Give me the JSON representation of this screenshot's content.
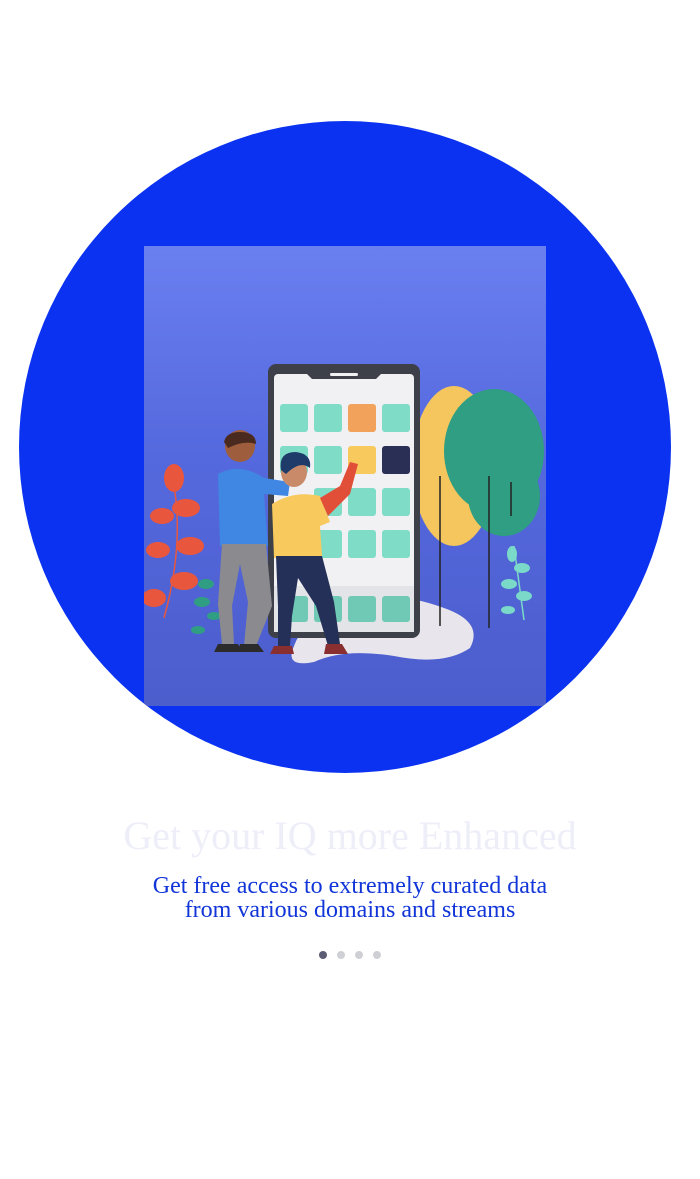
{
  "onboarding": {
    "headline": "Get your IQ more Enhanced",
    "subtitle": "Get free access to extremely curated data from various domains and streams",
    "illustration": "people-using-phone-app-illustration",
    "pager": {
      "total_pages": 4,
      "active_page": 1
    }
  },
  "colors": {
    "accent": "#0a32f0",
    "subtitle_text": "#1135d8",
    "headline_text": "#eeeef9",
    "pager_active": "#5c5c74",
    "pager_inactive": "#cfcfd6"
  }
}
